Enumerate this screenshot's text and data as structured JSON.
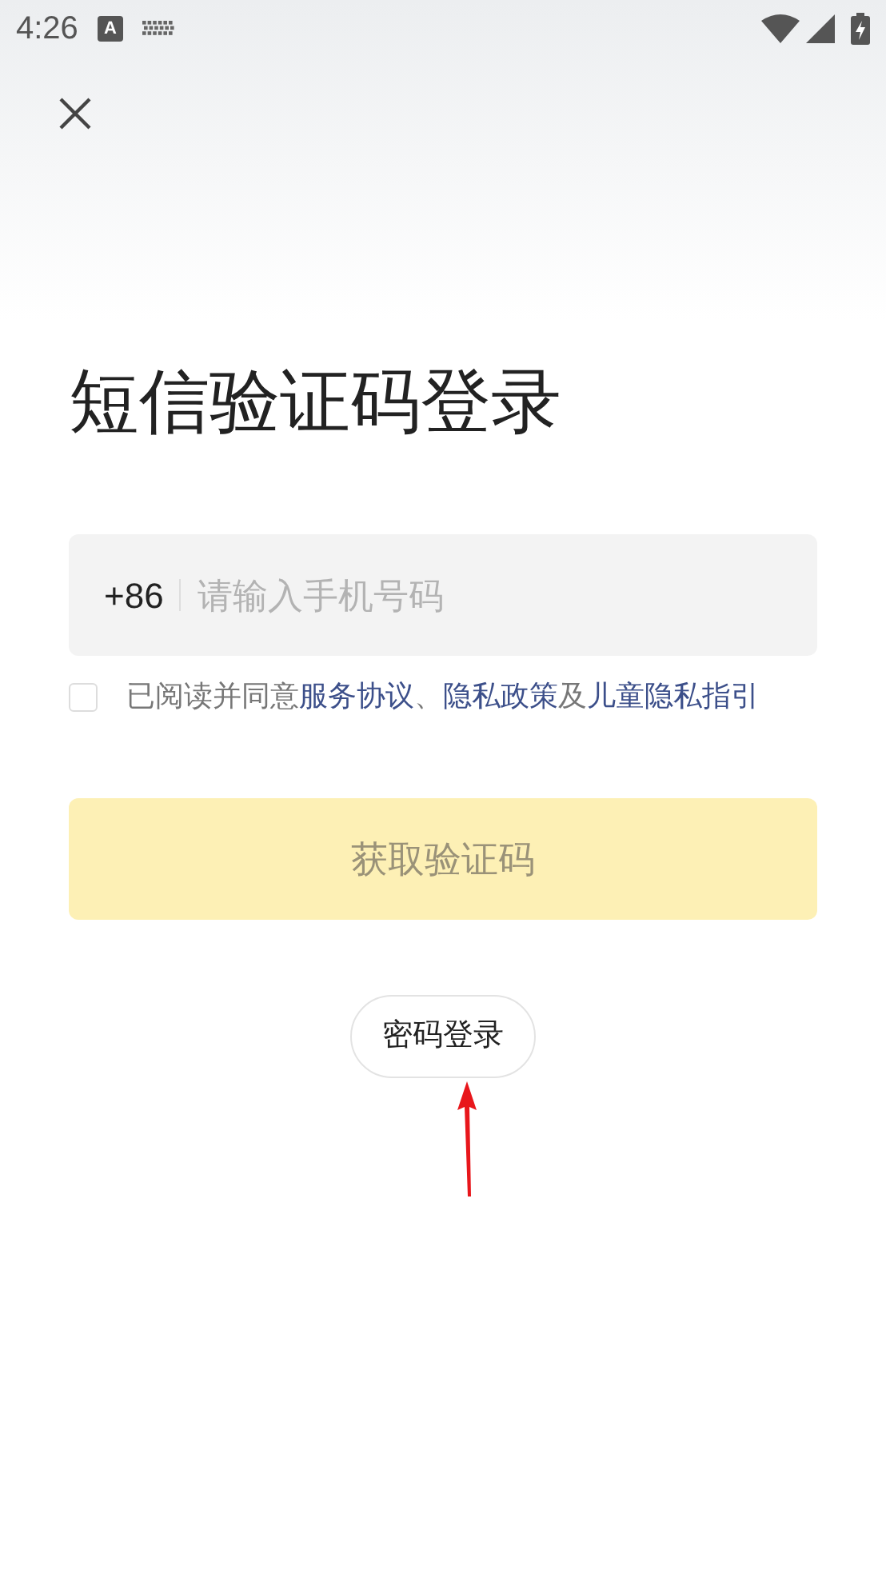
{
  "status_bar": {
    "time": "4:26",
    "ime_badge": "A"
  },
  "title": "短信验证码登录",
  "phone_field": {
    "country_code": "+86",
    "placeholder": "请输入手机号码"
  },
  "agreement": {
    "checked": false,
    "segments": [
      {
        "kind": "plain",
        "text": "已阅读并同意"
      },
      {
        "kind": "link",
        "text": "服务协议"
      },
      {
        "kind": "plain",
        "text": "、"
      },
      {
        "kind": "link",
        "text": "隐私政策"
      },
      {
        "kind": "plain",
        "text": "及"
      },
      {
        "kind": "link",
        "text": "儿童隐私指引"
      }
    ]
  },
  "submit_button": {
    "label": "获取验证码",
    "disabled": true
  },
  "password_login_button": {
    "label": "密码登录"
  }
}
